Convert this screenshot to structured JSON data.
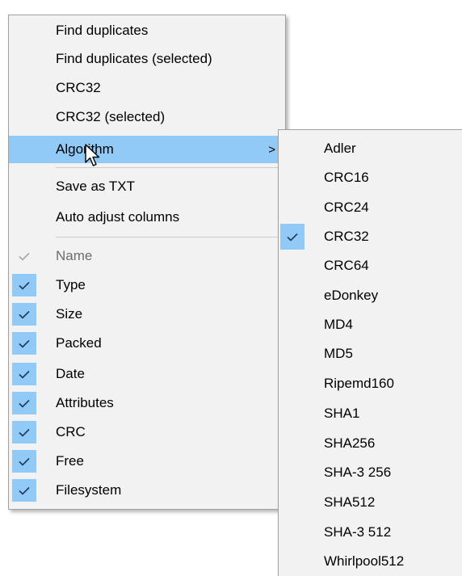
{
  "main_menu": {
    "items": [
      {
        "label": "Find duplicates"
      },
      {
        "label": "Find duplicates (selected)"
      },
      {
        "label": "CRC32"
      },
      {
        "label": "CRC32 (selected)"
      },
      {
        "label": "Algorithm",
        "submenu_arrow": ">"
      },
      {
        "label": "Save as TXT"
      },
      {
        "label": "Auto adjust columns"
      }
    ],
    "columns": [
      {
        "label": "Name",
        "checked": true,
        "disabled": true
      },
      {
        "label": "Type",
        "checked": true
      },
      {
        "label": "Size",
        "checked": true
      },
      {
        "label": "Packed",
        "checked": true
      },
      {
        "label": "Date",
        "checked": true
      },
      {
        "label": "Attributes",
        "checked": true
      },
      {
        "label": "CRC",
        "checked": true
      },
      {
        "label": "Free",
        "checked": true
      },
      {
        "label": "Filesystem",
        "checked": true
      }
    ]
  },
  "algorithm_submenu": {
    "items": [
      {
        "label": "Adler"
      },
      {
        "label": "CRC16"
      },
      {
        "label": "CRC24"
      },
      {
        "label": "CRC32",
        "checked": true
      },
      {
        "label": "CRC64"
      },
      {
        "label": "eDonkey"
      },
      {
        "label": "MD4"
      },
      {
        "label": "MD5"
      },
      {
        "label": "Ripemd160"
      },
      {
        "label": "SHA1"
      },
      {
        "label": "SHA256"
      },
      {
        "label": "SHA-3 256"
      },
      {
        "label": "SHA512"
      },
      {
        "label": "SHA-3 512"
      },
      {
        "label": "Whirlpool512"
      }
    ]
  },
  "colors": {
    "menu_bg": "#f2f2f2",
    "highlight": "#91c9f7",
    "check_dark": "#1f3a5a",
    "check_disabled": "#a7a7a7",
    "text": "#000000",
    "disabled_text": "#6d6d6d"
  }
}
